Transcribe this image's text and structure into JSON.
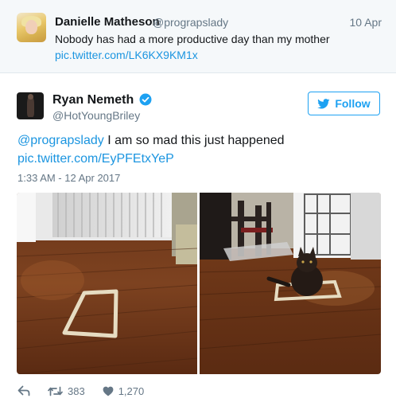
{
  "parent_tweet": {
    "name": "Danielle Matheson",
    "handle": "@prograpslady",
    "date": "10 Apr",
    "text": "Nobody has had a more productive day than my mother",
    "link": "pic.twitter.com/LK6KX9KM1x"
  },
  "tweet": {
    "name": "Ryan Nemeth",
    "verified": true,
    "handle": "@HotYoungBriley",
    "follow_label": "Follow",
    "mention": "@prograpslady",
    "text": " I am so mad this just happened",
    "link": "pic.twitter.com/EyPFEtxYeP",
    "timestamp": "1:33 AM - 12 Apr 2017",
    "retweets": "383",
    "likes": "1,270"
  },
  "colors": {
    "link_blue": "#1b95e0",
    "twitter_blue": "#1da1f2",
    "muted_gray": "#657786",
    "parent_bg": "#f5f8fa"
  },
  "icons": {
    "avatar_parent": "avatar",
    "avatar_main": "avatar",
    "verified": "verified-badge-icon",
    "follow": "twitter-bird-icon",
    "reply": "reply-icon",
    "retweet": "retweet-icon",
    "like": "heart-icon"
  }
}
